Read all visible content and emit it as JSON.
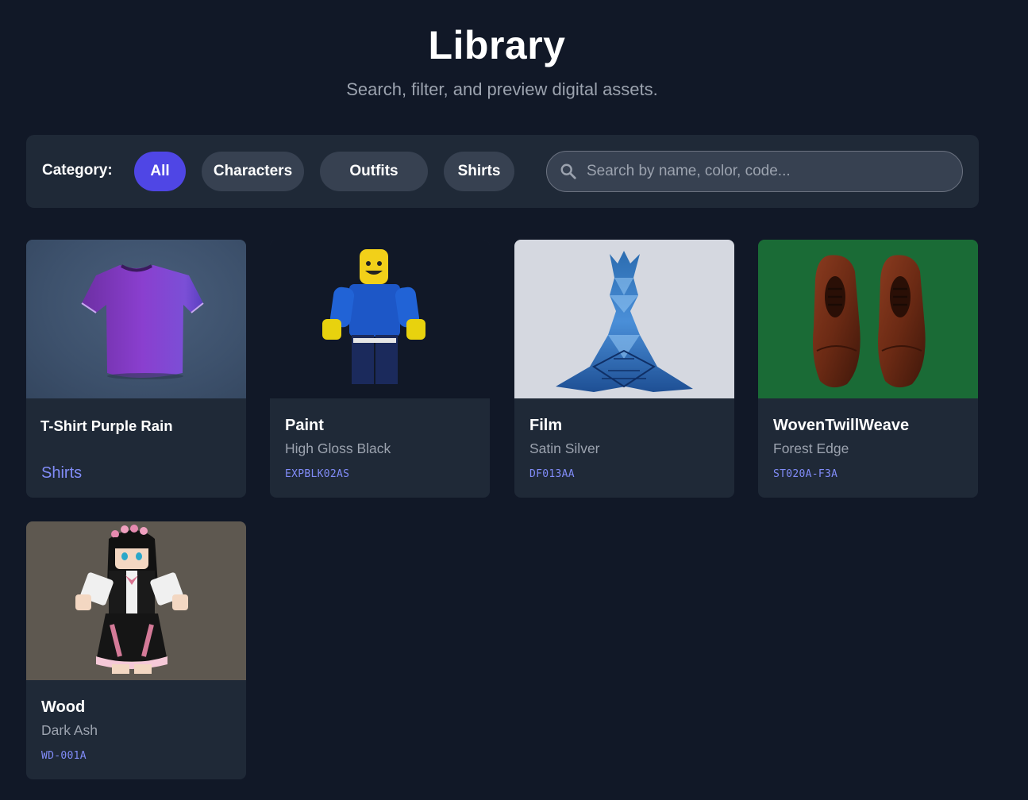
{
  "header": {
    "title": "Library",
    "subtitle": "Search, filter, and preview digital assets."
  },
  "filters": {
    "label": "Category:",
    "chips": [
      "All",
      "Characters",
      "Outfits",
      "Shirts"
    ],
    "active": "All"
  },
  "search": {
    "placeholder": "Search by name, color, code...",
    "value": ""
  },
  "cards": [
    {
      "name": "T-Shirt Purple Rain",
      "tag": "Shirts",
      "thumb_bg": "#3d516c",
      "icon": "tshirt-icon"
    },
    {
      "name": "Paint",
      "subtitle": "High Gloss Black",
      "code": "EXPBLK02AS",
      "thumb_bg": "#111827",
      "icon": "character-figure-icon"
    },
    {
      "name": "Film",
      "subtitle": "Satin Silver",
      "code": "DF013AA",
      "thumb_bg": "#d5d8e0",
      "icon": "gown-icon"
    },
    {
      "name": "WovenTwillWeave",
      "subtitle": "Forest Edge",
      "code": "ST020A-F3A",
      "thumb_bg": "#1a6b36",
      "icon": "shoes-icon"
    },
    {
      "name": "Wood",
      "subtitle": "Dark Ash",
      "code": "WD-001A",
      "thumb_bg": "#5e5850",
      "icon": "doll-icon"
    }
  ],
  "colors": {
    "background": "#111827",
    "panel": "#1f2937",
    "chip": "#374151",
    "accent": "#4f46e5",
    "code_text": "#818cf8"
  }
}
